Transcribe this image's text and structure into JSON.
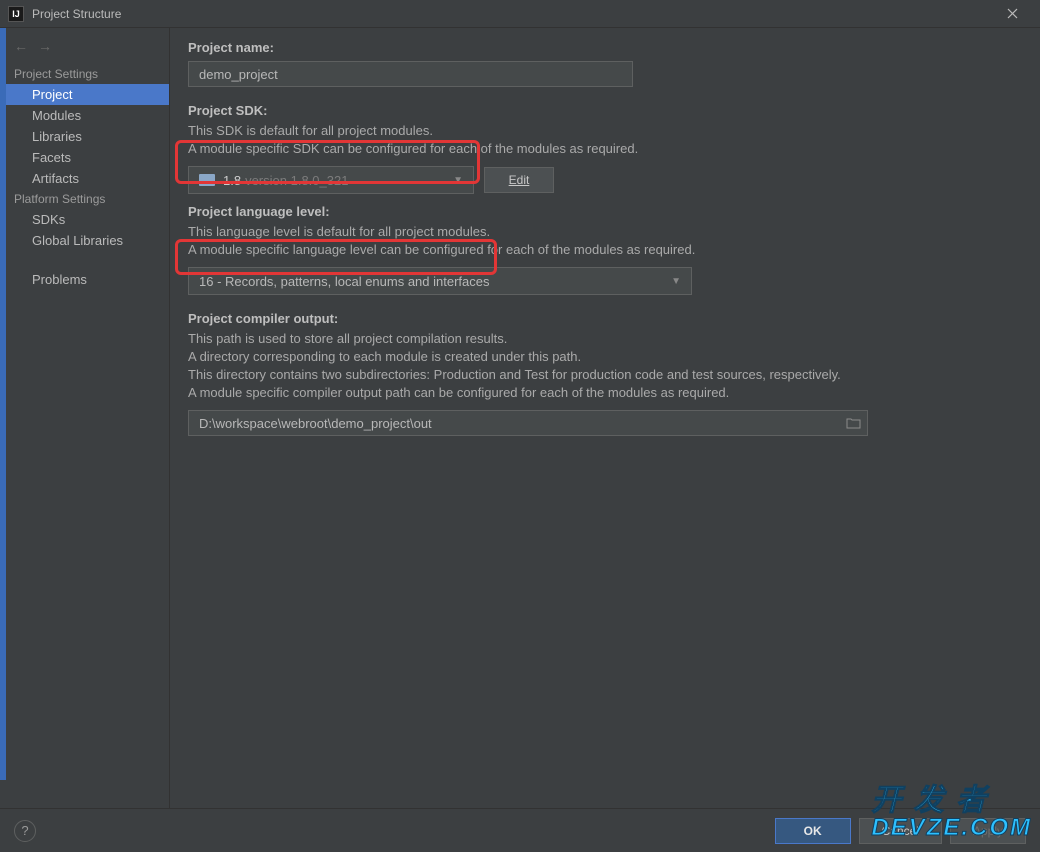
{
  "window": {
    "title": "Project Structure",
    "icon_text": "IJ"
  },
  "sidebar": {
    "sections": {
      "project_settings": {
        "label": "Project Settings",
        "items": [
          {
            "label": "Project",
            "selected": true
          },
          {
            "label": "Modules",
            "selected": false
          },
          {
            "label": "Libraries",
            "selected": false
          },
          {
            "label": "Facets",
            "selected": false
          },
          {
            "label": "Artifacts",
            "selected": false
          }
        ]
      },
      "platform_settings": {
        "label": "Platform Settings",
        "items": [
          {
            "label": "SDKs",
            "selected": false
          },
          {
            "label": "Global Libraries",
            "selected": false
          }
        ]
      },
      "problems": {
        "items": [
          {
            "label": "Problems",
            "selected": false
          }
        ]
      }
    }
  },
  "main": {
    "project_name": {
      "label": "Project name:",
      "value": "demo_project"
    },
    "project_sdk": {
      "label": "Project SDK:",
      "desc1": "This SDK is default for all project modules.",
      "desc2": "A module specific SDK can be configured for each of the modules as required.",
      "selected_main": "1.8",
      "selected_sub": "version 1.8.0_321",
      "edit_label": "Edit"
    },
    "language_level": {
      "label": "Project language level:",
      "desc1": "This language level is default for all project modules.",
      "desc2": "A module specific language level can be configured for each of the modules as required.",
      "selected": "16 - Records, patterns, local enums and interfaces"
    },
    "compiler_output": {
      "label": "Project compiler output:",
      "desc1": "This path is used to store all project compilation results.",
      "desc2": "A directory corresponding to each module is created under this path.",
      "desc3": "This directory contains two subdirectories: Production and Test for production code and test sources, respectively.",
      "desc4": "A module specific compiler output path can be configured for each of the modules as required.",
      "value": "D:\\workspace\\webroot\\demo_project\\out"
    }
  },
  "buttons": {
    "ok": "OK",
    "cancel": "Cancel",
    "apply": "Apply"
  },
  "watermark": {
    "line1": "开 发 者",
    "line2": "DEVZE.COM"
  }
}
